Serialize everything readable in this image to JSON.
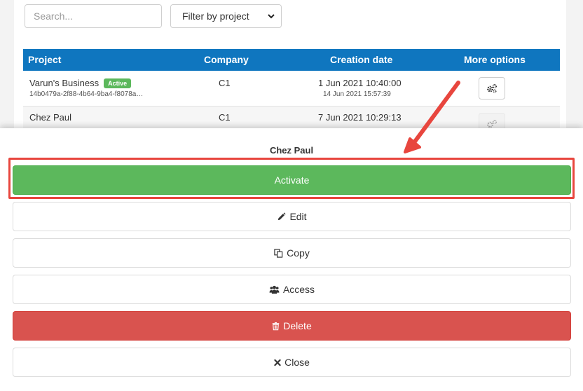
{
  "toolbar": {
    "search_placeholder": "Search...",
    "filter_label": "Filter by project"
  },
  "table": {
    "headers": {
      "project": "Project",
      "company": "Company",
      "creation_date": "Creation date",
      "more_options": "More options"
    },
    "rows": [
      {
        "project": "Varun's Business",
        "badge": "Active",
        "id": "14b0479a-2f88-4b64-9ba4-f8078a…",
        "company": "C1",
        "created": "1 Jun 2021 10:40:00",
        "modified": "14 Jun 2021 15:57:39"
      },
      {
        "project": "Chez Paul",
        "company": "C1",
        "created": "7 Jun 2021 10:29:13"
      }
    ]
  },
  "sheet": {
    "title": "Chez Paul",
    "actions": {
      "activate": "Activate",
      "edit": "Edit",
      "copy": "Copy",
      "access": "Access",
      "delete": "Delete",
      "close": "Close"
    }
  },
  "colors": {
    "header_blue": "#0f76bf",
    "success_green": "#5cb85c",
    "danger_red": "#d9534f",
    "annotation_red": "#e8463e"
  },
  "icons": {
    "gear": "gears-icon",
    "edit": "pencil-icon",
    "copy": "copy-icon",
    "access": "users-icon",
    "delete": "trash-icon",
    "close": "close-icon"
  }
}
